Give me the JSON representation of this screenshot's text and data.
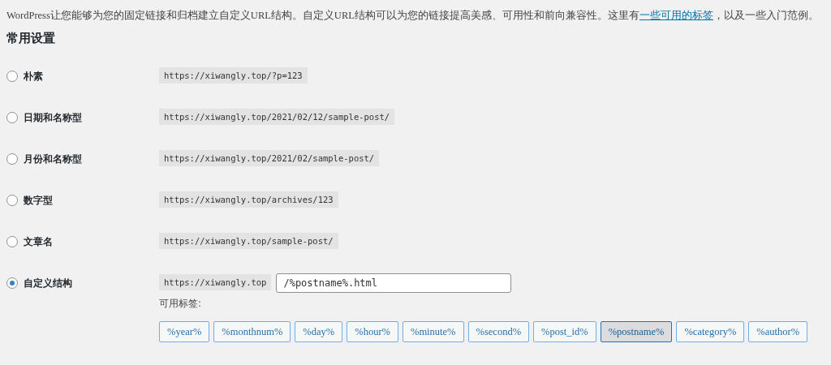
{
  "intro": {
    "before": "WordPress让您能够为您的固定链接和归档建立自定义URL结构。自定义URL结构可以为您的链接提高美感、可用性和前向兼容性。这里有",
    "link": "一些可用的标签",
    "after": "，以及一些入门范例。"
  },
  "heading": "常用设置",
  "options": [
    {
      "label": "朴素",
      "example": "https://xiwangly.top/?p=123",
      "selected": false,
      "kind": "preset"
    },
    {
      "label": "日期和名称型",
      "example": "https://xiwangly.top/2021/02/12/sample-post/",
      "selected": false,
      "kind": "preset"
    },
    {
      "label": "月份和名称型",
      "example": "https://xiwangly.top/2021/02/sample-post/",
      "selected": false,
      "kind": "preset"
    },
    {
      "label": "数字型",
      "example": "https://xiwangly.top/archives/123",
      "selected": false,
      "kind": "preset"
    },
    {
      "label": "文章名",
      "example": "https://xiwangly.top/sample-post/",
      "selected": false,
      "kind": "preset"
    },
    {
      "label": "自定义结构",
      "example": "https://xiwangly.top",
      "selected": true,
      "kind": "custom",
      "value": "/%postname%.html",
      "tags_label": "可用标签:",
      "tags": [
        {
          "label": "%year%",
          "selected": false
        },
        {
          "label": "%monthnum%",
          "selected": false
        },
        {
          "label": "%day%",
          "selected": false
        },
        {
          "label": "%hour%",
          "selected": false
        },
        {
          "label": "%minute%",
          "selected": false
        },
        {
          "label": "%second%",
          "selected": false
        },
        {
          "label": "%post_id%",
          "selected": false
        },
        {
          "label": "%postname%",
          "selected": true
        },
        {
          "label": "%category%",
          "selected": false
        },
        {
          "label": "%author%",
          "selected": false
        }
      ]
    }
  ]
}
